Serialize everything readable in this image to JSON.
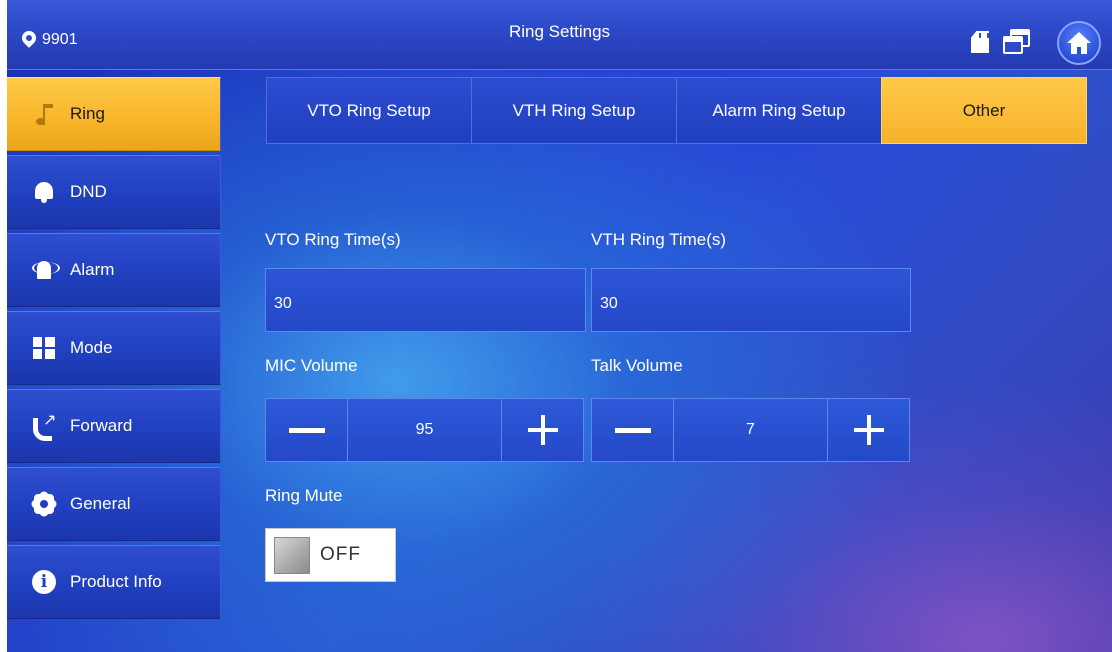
{
  "header": {
    "location_id": "9901",
    "title": "Ring Settings",
    "icons": [
      "location-pin-icon",
      "sd-card-icon",
      "windows-icon",
      "home-icon"
    ]
  },
  "sidebar": {
    "items": [
      {
        "label": "Ring",
        "icon": "music-note-icon",
        "active": true
      },
      {
        "label": "DND",
        "icon": "bell-icon",
        "active": false
      },
      {
        "label": "Alarm",
        "icon": "alarm-icon",
        "active": false
      },
      {
        "label": "Mode",
        "icon": "grid-icon",
        "active": false
      },
      {
        "label": "Forward",
        "icon": "phone-forward-icon",
        "active": false
      },
      {
        "label": "General",
        "icon": "gear-icon",
        "active": false
      },
      {
        "label": "Product Info",
        "icon": "info-icon",
        "active": false
      }
    ]
  },
  "tabs": [
    {
      "label": "VTO Ring Setup",
      "active": false
    },
    {
      "label": "VTH Ring Setup",
      "active": false
    },
    {
      "label": "Alarm Ring Setup",
      "active": false
    },
    {
      "label": "Other",
      "active": true
    }
  ],
  "form": {
    "vto_ring_time": {
      "label": "VTO Ring Time(s)",
      "value": "30"
    },
    "vth_ring_time": {
      "label": "VTH Ring Time(s)",
      "value": "30"
    },
    "mic_volume": {
      "label": "MIC Volume",
      "value": "95"
    },
    "talk_volume": {
      "label": "Talk Volume",
      "value": "7"
    },
    "ring_mute": {
      "label": "Ring Mute",
      "state": "OFF"
    }
  },
  "colors": {
    "accent": "#f8b62a",
    "background": "#2240c8",
    "active_text": "#1a1a1a"
  }
}
